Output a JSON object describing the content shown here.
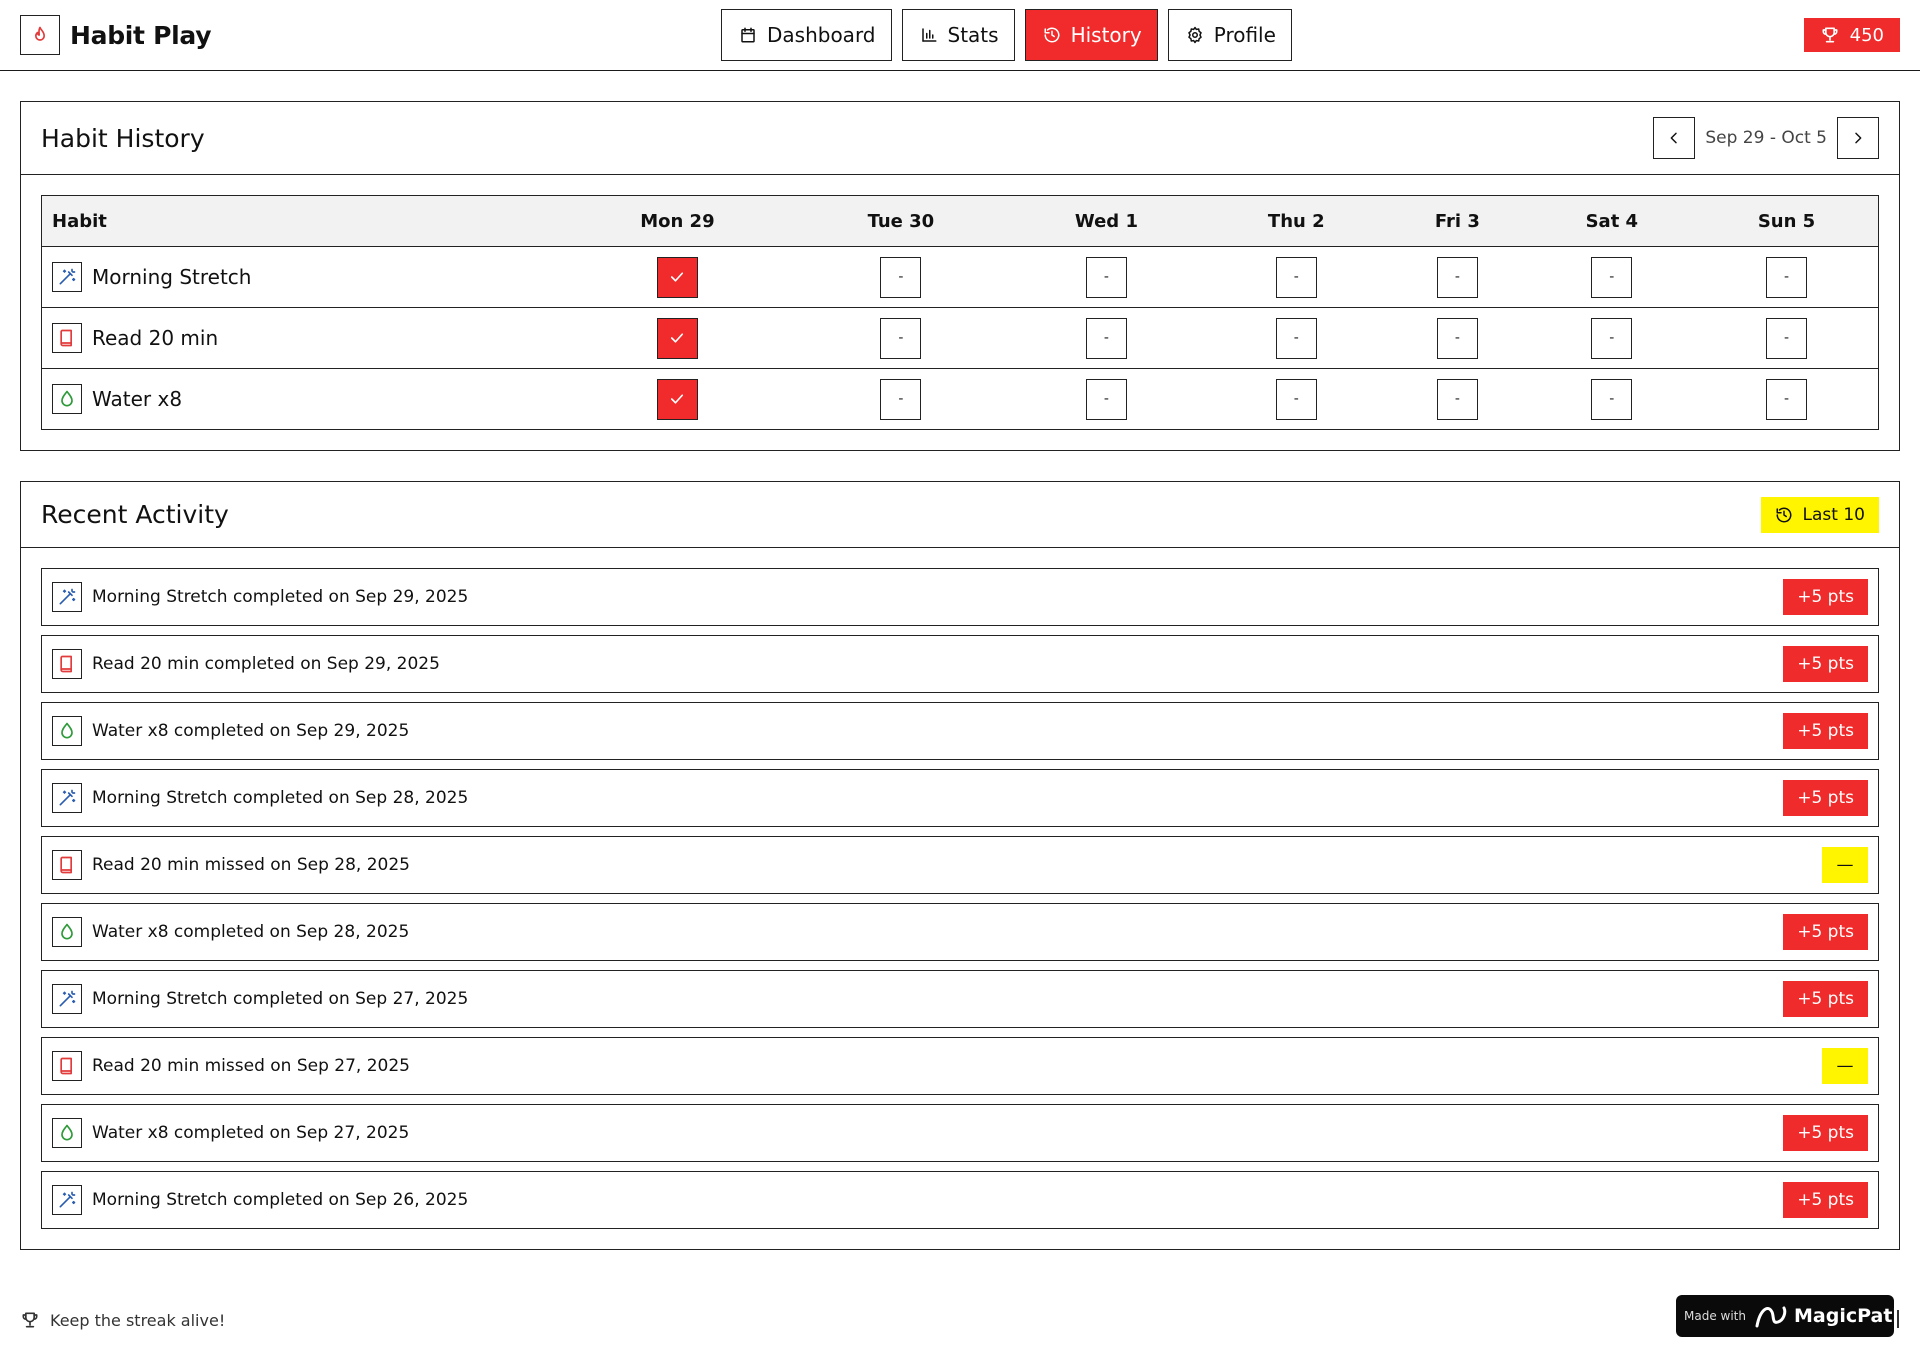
{
  "app": {
    "name": "Habit Play"
  },
  "nav": {
    "items": [
      {
        "label": "Dashboard",
        "icon": "calendar-icon",
        "active": false
      },
      {
        "label": "Stats",
        "icon": "bar-chart-icon",
        "active": false
      },
      {
        "label": "History",
        "icon": "history-icon",
        "active": true
      },
      {
        "label": "Profile",
        "icon": "gear-icon",
        "active": false
      }
    ]
  },
  "points": {
    "value": "450",
    "icon": "trophy-icon"
  },
  "history": {
    "title": "Habit History",
    "week_label": "Sep 29 - Oct 5",
    "columns": [
      "Habit",
      "Mon 29",
      "Tue 30",
      "Wed 1",
      "Thu 2",
      "Fri 3",
      "Sat 4",
      "Sun 5"
    ],
    "empty_mark": "-",
    "rows": [
      {
        "name": "Morning Stretch",
        "icon": "wand-icon",
        "days": [
          true,
          false,
          false,
          false,
          false,
          false,
          false
        ]
      },
      {
        "name": "Read 20 min",
        "icon": "book-icon",
        "days": [
          true,
          false,
          false,
          false,
          false,
          false,
          false
        ]
      },
      {
        "name": "Water x8",
        "icon": "droplet-icon",
        "days": [
          true,
          false,
          false,
          false,
          false,
          false,
          false
        ]
      }
    ]
  },
  "activity": {
    "title": "Recent Activity",
    "filter_label": "Last 10",
    "items": [
      {
        "text": "Morning Stretch completed on Sep 29, 2025",
        "icon": "wand-icon",
        "badge": "+5 pts",
        "missed": false
      },
      {
        "text": "Read 20 min completed on Sep 29, 2025",
        "icon": "book-icon",
        "badge": "+5 pts",
        "missed": false
      },
      {
        "text": "Water x8 completed on Sep 29, 2025",
        "icon": "droplet-icon",
        "badge": "+5 pts",
        "missed": false
      },
      {
        "text": "Morning Stretch completed on Sep 28, 2025",
        "icon": "wand-icon",
        "badge": "+5 pts",
        "missed": false
      },
      {
        "text": "Read 20 min missed on Sep 28, 2025",
        "icon": "book-icon",
        "badge": "—",
        "missed": true
      },
      {
        "text": "Water x8 completed on Sep 28, 2025",
        "icon": "droplet-icon",
        "badge": "+5 pts",
        "missed": false
      },
      {
        "text": "Morning Stretch completed on Sep 27, 2025",
        "icon": "wand-icon",
        "badge": "+5 pts",
        "missed": false
      },
      {
        "text": "Read 20 min missed on Sep 27, 2025",
        "icon": "book-icon",
        "badge": "—",
        "missed": true
      },
      {
        "text": "Water x8 completed on Sep 27, 2025",
        "icon": "droplet-icon",
        "badge": "+5 pts",
        "missed": false
      },
      {
        "text": "Morning Stretch completed on Sep 26, 2025",
        "icon": "wand-icon",
        "badge": "+5 pts",
        "missed": false
      }
    ]
  },
  "footer": {
    "text": "Keep the streak alive!"
  },
  "made_with": {
    "prefix": "Made with",
    "brand": "MagicPath"
  },
  "colors": {
    "accent_red": "#f12b2b",
    "accent_yellow": "#fff500",
    "wand_blue": "#2a5db0",
    "book_red": "#e23b3b",
    "droplet_green": "#2f9a3a"
  }
}
